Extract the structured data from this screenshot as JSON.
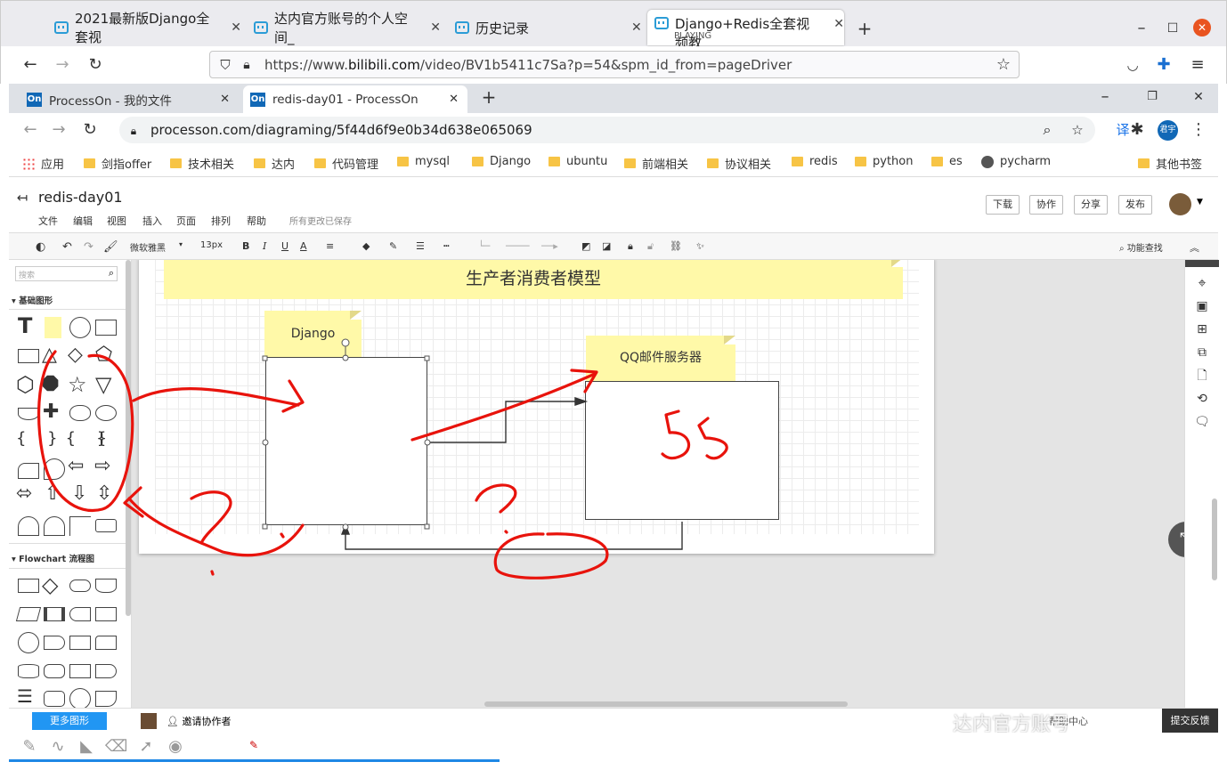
{
  "firefox": {
    "tabs": [
      {
        "title": "2021最新版Django全套视"
      },
      {
        "title": "达内官方账号的个人空间_"
      },
      {
        "title": "历史记录"
      },
      {
        "title": "Django+Redis全套视频教",
        "status": "PLAYING"
      }
    ],
    "url_prefix": "https://www.",
    "url_domain": "bilibili.com",
    "url_path": "/video/BV1b5411c7Sa?p=54&spm_id_from=pageDriver"
  },
  "chrome": {
    "tabs": [
      {
        "icon": "On",
        "title": "ProcessOn - 我的文件"
      },
      {
        "icon": "On",
        "title": "redis-day01 - ProcessOn"
      }
    ],
    "url": "processon.com/diagraming/5f44d6f9e0b34d638e065069",
    "translate_label": "译",
    "avatar_label": "君宇"
  },
  "bookmarks": [
    "应用",
    "剑指offer",
    "技术相关",
    "达内",
    "代码管理",
    "mysql",
    "Django",
    "ubuntu",
    "前端相关",
    "协议相关",
    "redis",
    "python",
    "es",
    "pycharm",
    "其他书签"
  ],
  "processon": {
    "doc_title": "redis-day01",
    "menu": [
      "文件",
      "编辑",
      "视图",
      "插入",
      "页面",
      "排列",
      "帮助"
    ],
    "save_status": "所有更改已保存",
    "buttons": [
      "下载",
      "协作",
      "分享",
      "发布"
    ],
    "toolbar": {
      "font": "微软雅黑",
      "size": "13px",
      "search": "功能查找"
    },
    "search_placeholder": "搜索",
    "sections": [
      "基础图形",
      "Flowchart 流程图"
    ],
    "more_shapes": "更多图形",
    "invite": "邀请协作者",
    "help": "帮助中心",
    "feedback": "提交反馈"
  },
  "diagram": {
    "title": "生产者消费者模型",
    "note1": "Django",
    "note2": "QQ邮件服务器",
    "handwriting": "55"
  },
  "watermark": "达内官方账号",
  "colors": {
    "accent": "#1168b6",
    "ink": "#e8130c",
    "note": "#fff9a8"
  }
}
